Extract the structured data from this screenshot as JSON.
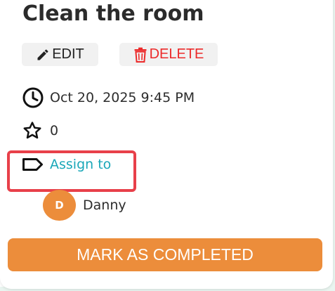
{
  "task": {
    "title": "Clean the room",
    "edit_label": "EDIT",
    "delete_label": "DELETE",
    "due_datetime": "Oct 20, 2025 9:45 PM",
    "stars_count": "0",
    "assign_label": "Assign to",
    "assignees": [
      {
        "initial": "D",
        "name": "Danny"
      }
    ],
    "complete_label": "MARK AS COMPLETED"
  },
  "icons": {
    "edit": "pencil-icon",
    "delete": "trash-icon",
    "date": "clock-icon",
    "stars": "star-icon",
    "assign": "tag-icon"
  },
  "colors": {
    "accent": "#ec8d3b",
    "danger": "#ec2a2a",
    "link": "#1aa7b8",
    "highlight": "#e8404a"
  }
}
